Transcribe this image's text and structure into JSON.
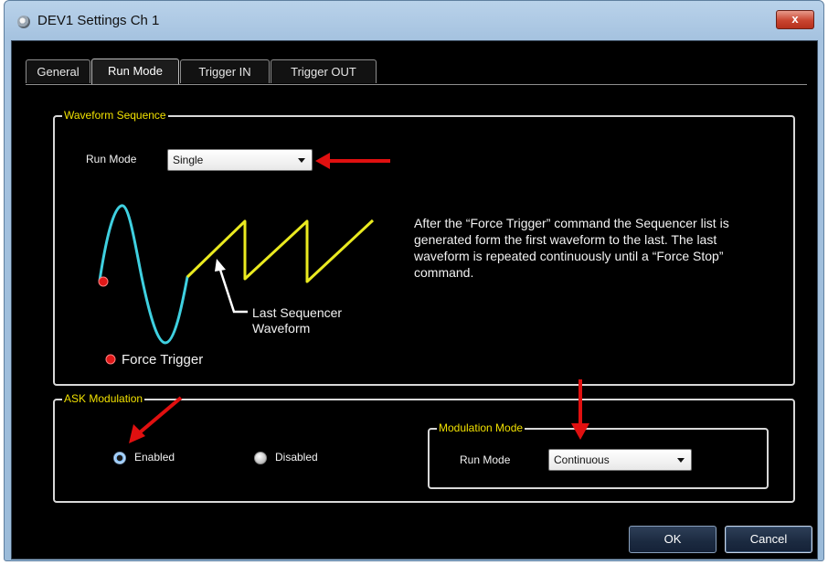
{
  "window": {
    "title": "DEV1 Settings Ch 1",
    "close_glyph": "x"
  },
  "tabs": [
    {
      "label": "General",
      "active": false
    },
    {
      "label": "Run Mode",
      "active": true
    },
    {
      "label": "Trigger IN",
      "active": false
    },
    {
      "label": "Trigger OUT",
      "active": false
    }
  ],
  "waveform_sequence": {
    "group_label": "Waveform Sequence",
    "run_mode_label": "Run Mode",
    "run_mode_value": "Single",
    "description": "After the “Force Trigger” command the Sequencer list is generated form the first waveform to the last. The last waveform is repeated continuously until a “Force Stop” command.",
    "callout_label_line1": "Last Sequencer",
    "callout_label_line2": "Waveform",
    "legend_label": "Force Trigger"
  },
  "ask_modulation": {
    "group_label": "ASK Modulation",
    "enabled_label": "Enabled",
    "disabled_label": "Disabled",
    "selected": "Enabled",
    "modulation_mode": {
      "group_label": "Modulation Mode",
      "run_mode_label": "Run Mode",
      "run_mode_value": "Continuous"
    }
  },
  "buttons": {
    "ok": "OK",
    "cancel": "Cancel"
  },
  "colors": {
    "accent_yellow": "#f0e000",
    "sine_cyan": "#3fd0e0",
    "annotation_red": "#e01010"
  }
}
